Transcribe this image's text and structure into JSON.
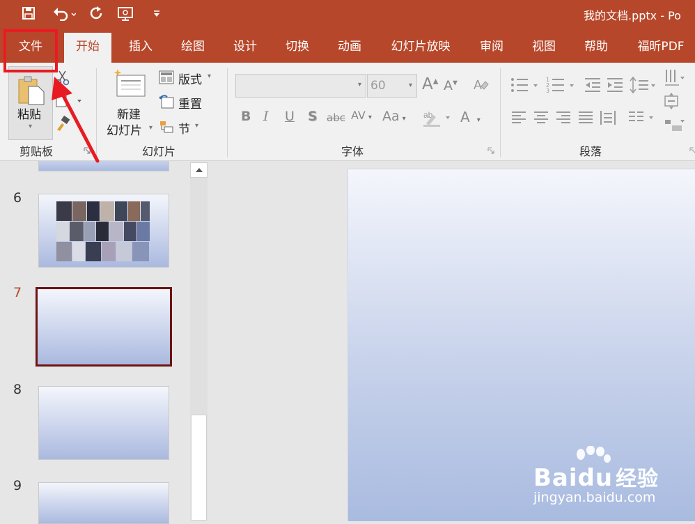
{
  "window": {
    "document_title": "我的文档.pptx  -  Po"
  },
  "qat": {
    "icons": [
      "save-icon",
      "undo-icon",
      "redo-icon",
      "presentation-icon",
      "customize-qat-icon"
    ]
  },
  "tabs": [
    "文件",
    "开始",
    "插入",
    "绘图",
    "设计",
    "切换",
    "动画",
    "幻灯片放映",
    "审阅",
    "视图",
    "帮助",
    "福昕PDF"
  ],
  "active_tab": "开始",
  "ribbon": {
    "clipboard": {
      "paste_label": "粘贴",
      "group_label": "剪贴板"
    },
    "slides": {
      "new_slide_line1": "新建",
      "new_slide_line2": "幻灯片",
      "layout_label": "版式",
      "reset_label": "重置",
      "section_label": "节",
      "group_label": "幻灯片"
    },
    "font": {
      "font_name_value": "",
      "font_size_value": "60",
      "bold": "B",
      "italic": "I",
      "underline": "U",
      "shadow": "S",
      "strikethrough": "abc",
      "spacing": "AV",
      "change_case": "Aa",
      "font_color": "A",
      "increase_font": "A",
      "decrease_font": "A",
      "group_label": "字体"
    },
    "paragraph": {
      "group_label": "段落"
    }
  },
  "slides": [
    {
      "number": "6",
      "has_photos": true,
      "selected": false
    },
    {
      "number": "7",
      "has_photos": false,
      "selected": true
    },
    {
      "number": "8",
      "has_photos": false,
      "selected": false
    },
    {
      "number": "9",
      "has_photos": false,
      "selected": false
    }
  ],
  "watermark": {
    "brand": "Bai",
    "brand2": "du",
    "suffix": "经验",
    "url": "jingyan.baidu.com"
  },
  "colors": {
    "accent": "#b7472a",
    "highlight": "#e81b23",
    "slide_selected_border": "#6e1212"
  }
}
